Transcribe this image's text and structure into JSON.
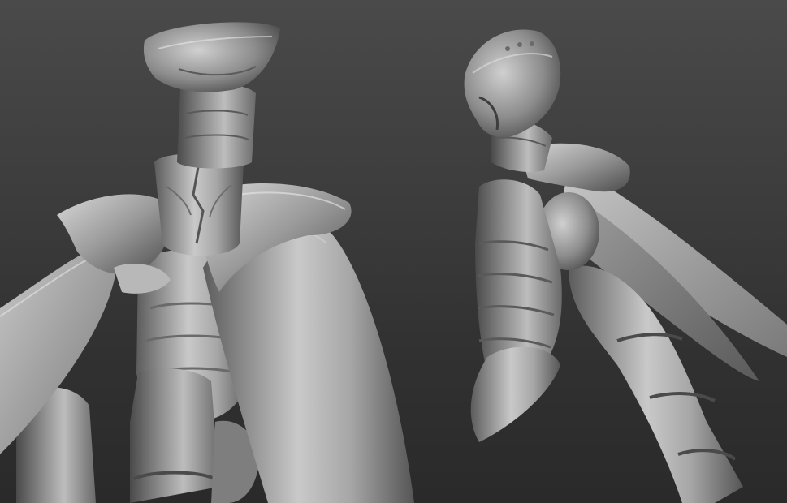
{
  "scene": {
    "description_free": true,
    "colors": {
      "background_top": "#4a4a4a",
      "background_bottom": "#2a2a2a",
      "clay_light": "#d2d2d2",
      "clay_mid": "#9c9c9c",
      "clay_dark": "#4b4b4b"
    }
  }
}
